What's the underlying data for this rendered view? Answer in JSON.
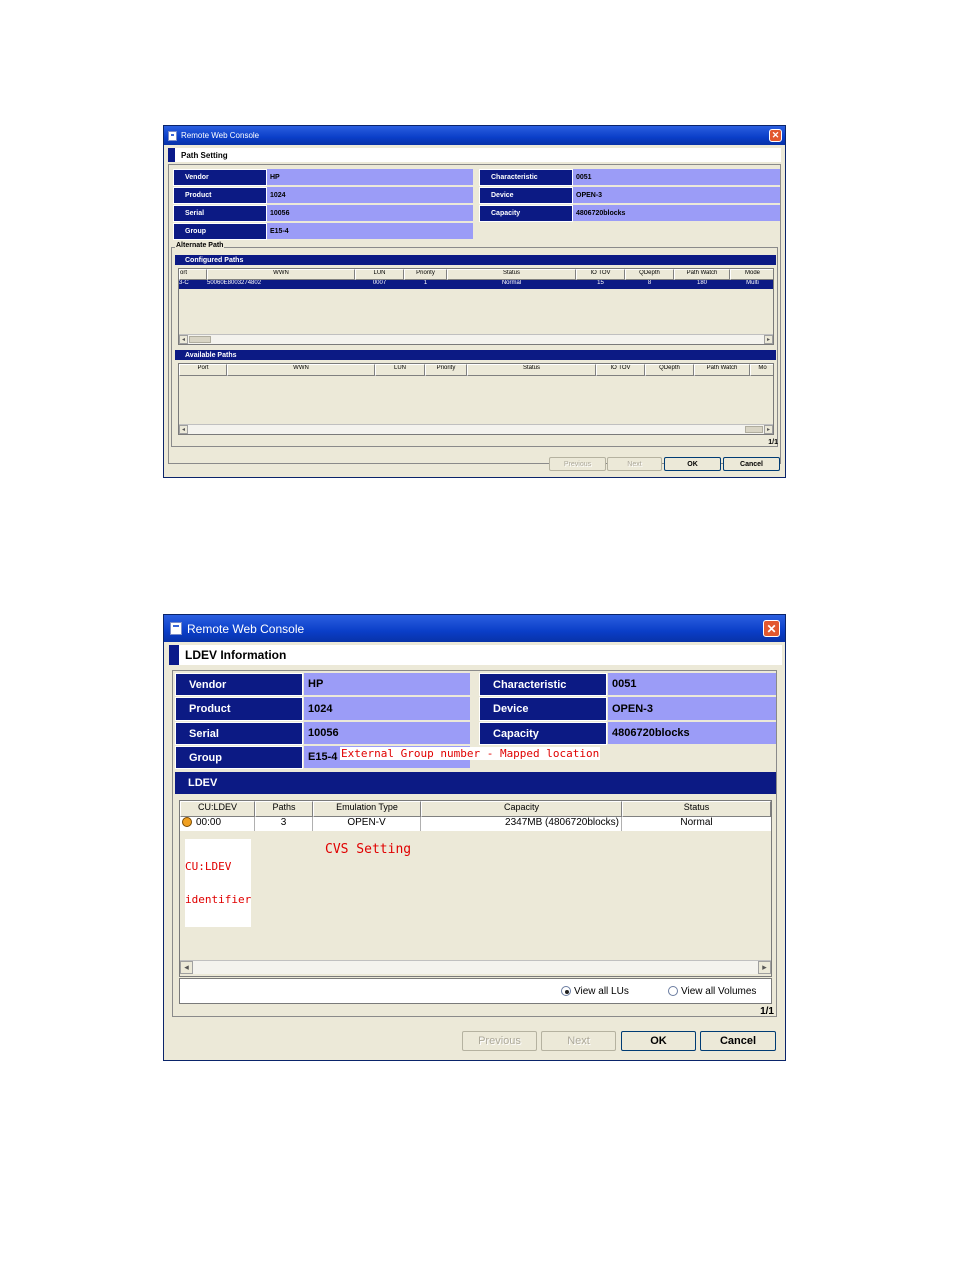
{
  "path_window": {
    "title": "Remote Web Console",
    "heading": "Path Setting",
    "fields": {
      "vendor_label": "Vendor",
      "vendor": "HP",
      "product_label": "Product",
      "product": "1024",
      "serial_label": "Serial",
      "serial": "10056",
      "group_label": "Group",
      "group": "E15-4",
      "characteristic_label": "Characteristic",
      "characteristic": "0051",
      "device_label": "Device",
      "device": "OPEN-3",
      "capacity_label": "Capacity",
      "capacity": "4806720blocks"
    },
    "alternate_path_label": "Alternate Path",
    "configured_paths": {
      "title": "Configured Paths",
      "columns": [
        "ort",
        "WWN",
        "LUN",
        "Priority",
        "Status",
        "IO TOV",
        "QDepth",
        "Path Watch",
        "Mode"
      ],
      "rows": [
        [
          "3-C",
          "50060E8003274802",
          "0007",
          "1",
          "Normal",
          "15",
          "8",
          "180",
          "Multi"
        ]
      ]
    },
    "available_paths": {
      "title": "Available Paths",
      "columns": [
        "Port",
        "WWN",
        "LUN",
        "Priority",
        "Status",
        "IO TOV",
        "QDepth",
        "Path Watch",
        "Mo"
      ]
    },
    "pager": "1/1",
    "buttons": {
      "previous": "Previous",
      "next": "Next",
      "ok": "OK",
      "cancel": "Cancel"
    }
  },
  "ldev_window": {
    "title": "Remote Web Console",
    "heading": "LDEV Information",
    "fields": {
      "vendor_label": "Vendor",
      "vendor": "HP",
      "product_label": "Product",
      "product": "1024",
      "serial_label": "Serial",
      "serial": "10056",
      "group_label": "Group",
      "group": "E15-4",
      "characteristic_label": "Characteristic",
      "characteristic": "0051",
      "device_label": "Device",
      "device": "OPEN-3",
      "capacity_label": "Capacity",
      "capacity": "4806720blocks"
    },
    "ldev_label": "LDEV",
    "table": {
      "columns": [
        "CU:LDEV",
        "Paths",
        "Emulation Type",
        "Capacity",
        "Status"
      ],
      "rows": [
        [
          "00:00",
          "3",
          "OPEN-V",
          "2347MB (4806720blocks)",
          "Normal"
        ]
      ]
    },
    "view_options": {
      "view_all_lus": "View all LUs",
      "view_all_volumes": "View all Volumes"
    },
    "pager": "1/1",
    "buttons": {
      "previous": "Previous",
      "next": "Next",
      "ok": "OK",
      "cancel": "Cancel"
    },
    "annotations": {
      "group_note": "External Group number - Mapped location",
      "cu_ldev_note_1": "CU:LDEV",
      "cu_ldev_note_2": "identifier",
      "cvs_note": "CVS Setting"
    }
  },
  "colors": {
    "label_bg": "#0c1a84",
    "value_bg": "#9b9cf7",
    "titlebar": "#0a3ec8",
    "annotation": "#e00000"
  }
}
